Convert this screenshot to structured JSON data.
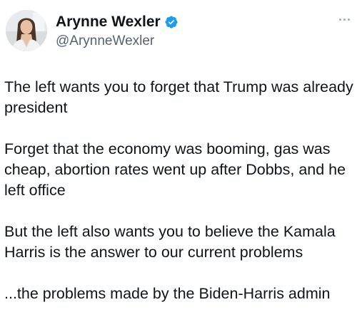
{
  "author": {
    "display_name": "Arynne Wexler",
    "handle": "@ArynneWexler",
    "verified": true,
    "avatar_icon": "profile-photo-icon",
    "verified_icon": "verified-badge-icon",
    "verified_color": "#1d9bf0"
  },
  "more_icon": "more-options-icon",
  "tweet": {
    "paragraphs": [
      "The left wants you to forget that Trump was already president",
      "Forget that the economy was booming, gas was cheap, abortion rates went up after Dobbs, and he left office",
      "But the left also wants you to believe the Kamala Harris is the answer to our current problems",
      "...the problems made by the Biden-Harris admin"
    ]
  }
}
